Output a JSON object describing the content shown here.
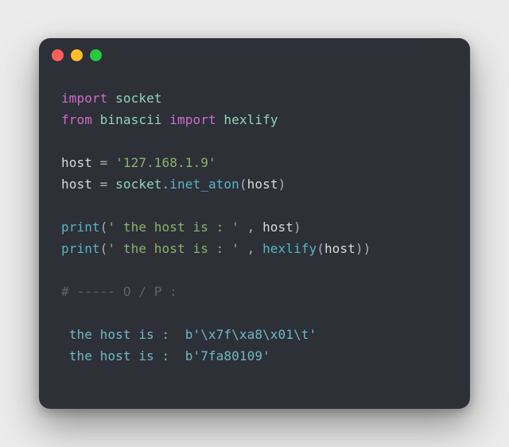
{
  "window": {
    "dots": {
      "red": "#ff5f56",
      "yellow": "#ffbd2e",
      "green": "#27c93f"
    }
  },
  "code": {
    "l1": {
      "kw": "import",
      "sp": " ",
      "mod": "socket"
    },
    "l2": {
      "kw": "from",
      "sp1": " ",
      "mod1": "binascii",
      "sp2": " ",
      "kw2": "import",
      "sp3": " ",
      "mod2": "hexlify"
    },
    "l3": "",
    "l4": {
      "ident": "host",
      "sp1": " ",
      "eq": "=",
      "sp2": " ",
      "str": "'127.168.1.9'"
    },
    "l5": {
      "ident": "host",
      "sp1": " ",
      "eq": "=",
      "sp2": " ",
      "mod": "socket",
      "dot": ".",
      "func": "inet_aton",
      "lp": "(",
      "arg": "host",
      "rp": ")"
    },
    "l6": "",
    "l7": {
      "func": "print",
      "lp": "(",
      "str": "' the host is : '",
      "sp": " ",
      "comma": ",",
      "sp2": " ",
      "arg": "host",
      "rp": ")"
    },
    "l8": {
      "func": "print",
      "lp": "(",
      "str": "' the host is : '",
      "sp": " ",
      "comma": ",",
      "sp2": " ",
      "func2": "hexlify",
      "lp2": "(",
      "arg": "host",
      "rp2": ")",
      "rp": ")"
    },
    "l9": "",
    "l10": {
      "comment": "# ----- O / P :"
    },
    "l11": "",
    "l12": {
      "out": " the host is :  b'\\x7f\\xa8\\x01\\t'"
    },
    "l13": {
      "out": " the host is :  b'7fa80109'"
    }
  }
}
